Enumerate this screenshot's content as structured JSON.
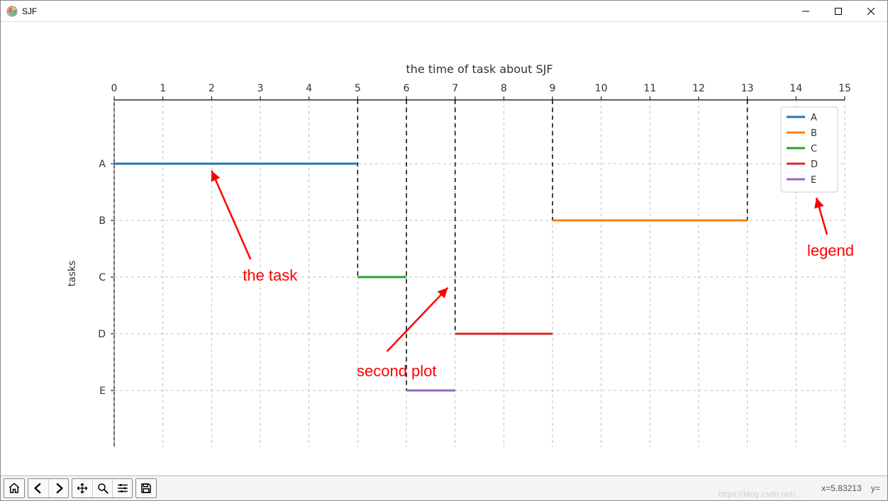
{
  "window": {
    "title": "SJF"
  },
  "toolbar": {
    "home": "Home",
    "back": "Back",
    "forward": "Forward",
    "pan": "Pan",
    "zoom": "Zoom",
    "configure": "Configure subplots",
    "save": "Save"
  },
  "status": {
    "coord": "x=5.83213    y="
  },
  "watermark": "https://blog.csdn.net/...",
  "chart_data": {
    "type": "gantt",
    "title": "the time of task about SJF",
    "xlabel": "",
    "ylabel": "tasks",
    "xlim": [
      0,
      15
    ],
    "ylim_categories": [
      "A",
      "B",
      "C",
      "D",
      "E"
    ],
    "x_ticks": [
      0,
      1,
      2,
      3,
      4,
      5,
      6,
      7,
      8,
      9,
      10,
      11,
      12,
      13,
      14,
      15
    ],
    "x_tick_position": "top",
    "grid": true,
    "series": [
      {
        "name": "A",
        "color": "#1f77b4",
        "y": "A",
        "x_start": 0,
        "x_end": 5
      },
      {
        "name": "B",
        "color": "#ff7f0e",
        "y": "B",
        "x_start": 9,
        "x_end": 13
      },
      {
        "name": "C",
        "color": "#2ca02c",
        "y": "C",
        "x_start": 5,
        "x_end": 6
      },
      {
        "name": "D",
        "color": "#d62728",
        "y": "D",
        "x_start": 7,
        "x_end": 9
      },
      {
        "name": "E",
        "color": "#9467bd",
        "y": "E",
        "x_start": 6,
        "x_end": 7
      }
    ],
    "transition_lines": {
      "style": "dashed",
      "color": "#000000",
      "at_x": [
        5,
        6,
        7,
        9,
        13
      ],
      "y_top_category": "A",
      "y_bottom_category_each": [
        "C",
        "E",
        "D",
        "B",
        "B"
      ]
    },
    "legend": {
      "position": "upper right",
      "entries": [
        "A",
        "B",
        "C",
        "D",
        "E"
      ]
    }
  },
  "annotations": {
    "the_task": "the task",
    "second_plot": "second plot",
    "legend_label": "legend"
  }
}
